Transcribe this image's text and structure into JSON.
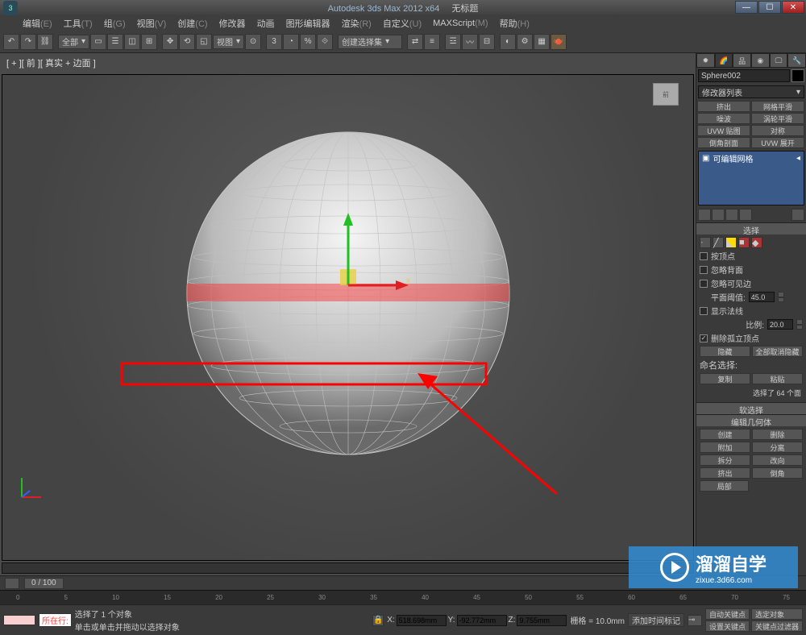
{
  "titlebar": {
    "app": "Autodesk 3ds Max 2012 x64",
    "file": "无标题"
  },
  "menus": [
    {
      "label": "编辑",
      "key": "(E)"
    },
    {
      "label": "工具",
      "key": "(T)"
    },
    {
      "label": "组",
      "key": "(G)"
    },
    {
      "label": "视图",
      "key": "(V)"
    },
    {
      "label": "创建",
      "key": "(C)"
    },
    {
      "label": "修改器",
      "key": ""
    },
    {
      "label": "动画",
      "key": ""
    },
    {
      "label": "图形编辑器",
      "key": ""
    },
    {
      "label": "渲染",
      "key": "(R)"
    },
    {
      "label": "自定义",
      "key": "(U)"
    },
    {
      "label": "MAXScript",
      "key": "(M)"
    },
    {
      "label": "帮助",
      "key": "(H)"
    }
  ],
  "toolbar": {
    "scope": "全部",
    "view": "视图",
    "selset": "创建选择集"
  },
  "viewport": {
    "label": "[ + ][ 前 ][ 真实 + 边面 ]"
  },
  "panel": {
    "object_name": "Sphere002",
    "modifier_list": "修改器列表",
    "presets": [
      "挤出",
      "网格平滑",
      "噪波",
      "涡轮平滑",
      "UVW 贴图",
      "对称",
      "倒角剖面",
      "UVW 展开"
    ],
    "stack_item": "可编辑网格"
  },
  "selection": {
    "header": "选择",
    "by_vertex": "按顶点",
    "ignore_backface": "忽略背面",
    "ignore_visible": "忽略可见边",
    "planar_thresh_label": "平面阈值:",
    "planar_thresh": "45.0",
    "show_normals": "显示法线",
    "scale_label": "比例:",
    "scale": "20.0",
    "delete_isolated": "删除孤立顶点",
    "hide": "隐藏",
    "unhide_all": "全部取消隐藏",
    "named_sel_label": "命名选择:",
    "copy": "复制",
    "paste": "粘贴",
    "status": "选择了 64 个面"
  },
  "rollouts": {
    "soft_sel": "软选择",
    "edit_geom": "编辑几何体",
    "create": "创建",
    "delete": "删除",
    "attach": "附加",
    "detach": "分离",
    "split": "拆分",
    "redirect": "改向",
    "extrude": "挤出",
    "bevel": "倒角",
    "local": "局部"
  },
  "timeline": {
    "range": "0 / 100",
    "ticks": [
      "0",
      "5",
      "10",
      "15",
      "20",
      "25",
      "30",
      "35",
      "40",
      "45",
      "50",
      "55",
      "60",
      "65",
      "70",
      "75"
    ]
  },
  "status": {
    "sel_info": "选择了 1 个对象",
    "prompt": "单击或单击并拖动以选择对象",
    "add_time_tag": "添加时间标记",
    "current": "所在行:",
    "x": "518.698mm",
    "y": "-92.772mm",
    "z": "9.755mm",
    "grid": "栅格 = 10.0mm",
    "auto_key": "自动关键点",
    "sel_lock": "选定对象",
    "set_key": "设置关键点",
    "key_filters": "关键点过滤器"
  },
  "watermark": {
    "brand": "溜溜自学",
    "url": "zixue.3d66.com"
  }
}
